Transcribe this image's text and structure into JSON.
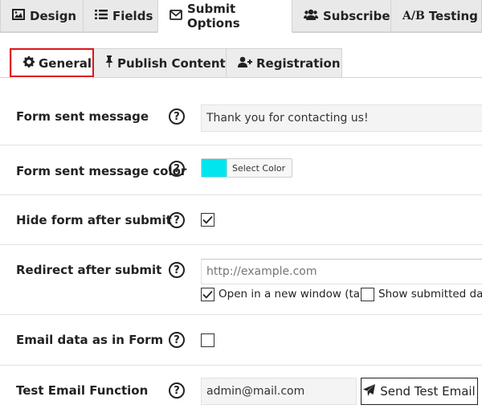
{
  "top_tabs": [
    {
      "label": "Design",
      "icon": "image-icon",
      "active": false
    },
    {
      "label": "Fields",
      "icon": "list-icon",
      "active": false
    },
    {
      "label": "Submit Options",
      "icon": "envelope-icon",
      "active": true
    },
    {
      "label": "Subscribe",
      "icon": "users-icon",
      "active": false
    },
    {
      "label": "Testing",
      "prefix": "A/B",
      "active": false
    }
  ],
  "sub_tabs": [
    {
      "label": "General",
      "icon": "gear-icon",
      "active": true
    },
    {
      "label": "Publish Content",
      "icon": "pin-icon",
      "active": false
    },
    {
      "label": "Registration",
      "icon": "user-plus-icon",
      "active": false
    }
  ],
  "help_symbol": "?",
  "form": {
    "sent_message": {
      "label": "Form sent message",
      "value": "Thank you for contacting us!"
    },
    "sent_message_color": {
      "label": "Form sent message color",
      "button_label": "Select Color",
      "color": "#00e5ee"
    },
    "hide_after_submit": {
      "label": "Hide form after submit",
      "checked": true
    },
    "redirect": {
      "label": "Redirect after submit",
      "placeholder": "http://example.com",
      "open_new_window": {
        "label": "Open in a new window (tab)",
        "checked": true
      },
      "show_submitted": {
        "label": "Show submitted data",
        "checked": false
      }
    },
    "email_data": {
      "label": "Email data as in Form",
      "checked": false
    },
    "test_email": {
      "label": "Test Email Function",
      "value": "admin@mail.com",
      "button_label": "Send Test Email"
    }
  }
}
